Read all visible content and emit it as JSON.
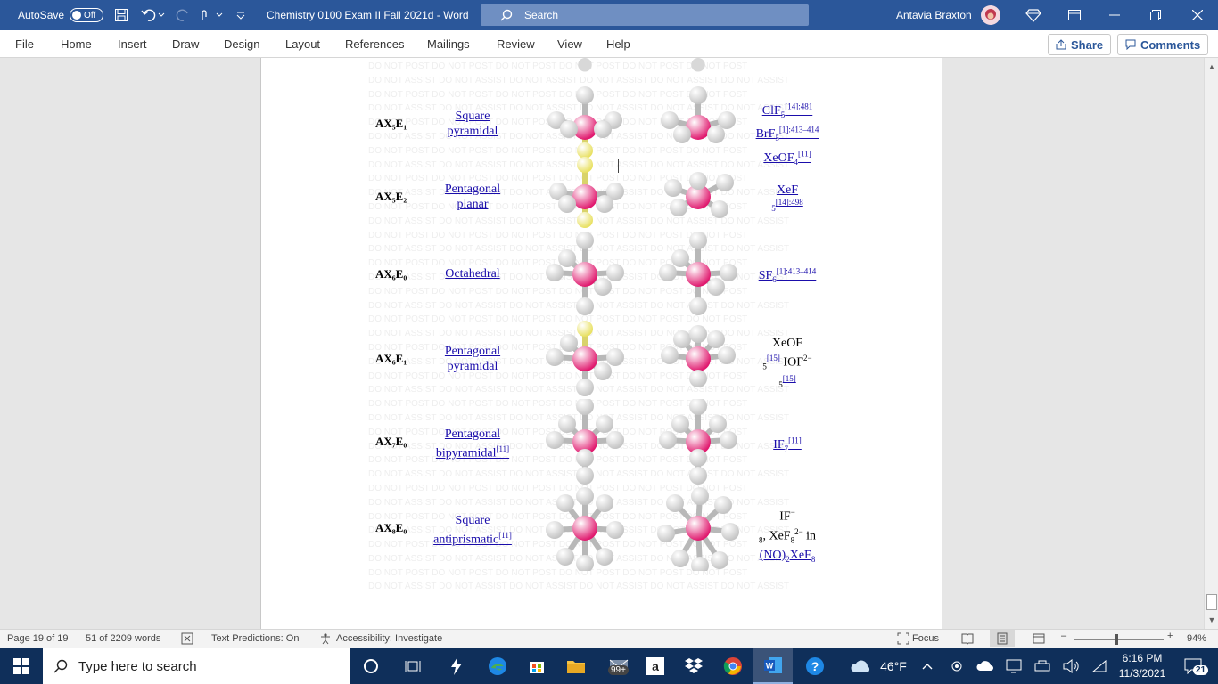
{
  "titlebar": {
    "autosave_label": "AutoSave",
    "autosave_state": "Off",
    "doc_title": "Chemistry 0100 Exam II Fall 2021d  -  Word",
    "search_placeholder": "Search",
    "user_name": "Antavia Braxton"
  },
  "ribbon": {
    "tabs": [
      "File",
      "Home",
      "Insert",
      "Draw",
      "Design",
      "Layout",
      "References",
      "Mailings",
      "Review",
      "View",
      "Help"
    ],
    "share_label": "Share",
    "comments_label": "Comments"
  },
  "document": {
    "watermark_text": "DO NOT POST",
    "watermark_text2": "DO NOT ASSIST",
    "rows": [
      {
        "ax": "AX₅E₁",
        "shape_lines": [
          "Square",
          "pyramidal"
        ],
        "examples": {
          "line1": "ClF",
          "line1_sub": "5",
          "line1_sup": "[14]:481",
          "line2": "BrF",
          "line2_sub": "5",
          "line2_sup": "[1]:413–414",
          "line3": "XeOF",
          "line3_sub": "4",
          "line3_sup": "[11]"
        }
      },
      {
        "ax": "AX₅E₂",
        "shape_lines": [
          "Pentagonal",
          "planar"
        ],
        "examples": {
          "line1": "XeF",
          "line2_sub": "5",
          "line2_sup": "[14]:498"
        }
      },
      {
        "ax": "AX₆E₀",
        "shape_lines": [
          "Octahedral"
        ],
        "examples": {
          "line1": "SF",
          "line1_sub": "6",
          "line1_sup": "[1]:413–414"
        }
      },
      {
        "ax": "AX₆E₁",
        "shape_lines": [
          "Pentagonal",
          "pyramidal"
        ],
        "examples": {
          "line1": "XeOF",
          "line2_sub": "5",
          "line2_ref": "[15]",
          "line2_text": " IOF",
          "line2_sup": "2−",
          "line3_sub": "5",
          "line3_ref": "[15]"
        }
      },
      {
        "ax": "AX₇E₀",
        "shape_lines": [
          "Pentagonal",
          "bipyramidal"
        ],
        "shape_sup": "[11]",
        "examples": {
          "line1": "IF",
          "line1_sub": "7",
          "line1_sup": "[11]"
        }
      },
      {
        "ax": "AX₈E₀",
        "shape_lines": [
          "Square",
          "antiprismatic"
        ],
        "shape_sup": "[11]",
        "examples": {
          "line1": "IF",
          "line1_sup": "−",
          "line2_sub": "8",
          "line2_text": ", XeF",
          "line2_sub2": "8",
          "line2_sup": "2−",
          "line2_tail": " in",
          "line3": "(NO)",
          "line3_sub": "2",
          "line3_tail": "XeF",
          "line3_sub2": "8"
        }
      }
    ]
  },
  "statusbar": {
    "page": "Page 19 of 19",
    "words": "51 of 2209 words",
    "text_predictions": "Text Predictions: On",
    "accessibility": "Accessibility: Investigate",
    "focus": "Focus",
    "zoom": "94%"
  },
  "taskbar": {
    "search_placeholder": "Type here to search",
    "mail_badge": "99+",
    "weather": "46°F",
    "time": "6:16 PM",
    "date": "11/3/2021",
    "notif_count": "21"
  },
  "colors": {
    "word_blue": "#2b579a",
    "link_blue": "#1a0dab",
    "atom_pink": "#e0196e",
    "lone_pair_yellow": "#e8e060"
  }
}
